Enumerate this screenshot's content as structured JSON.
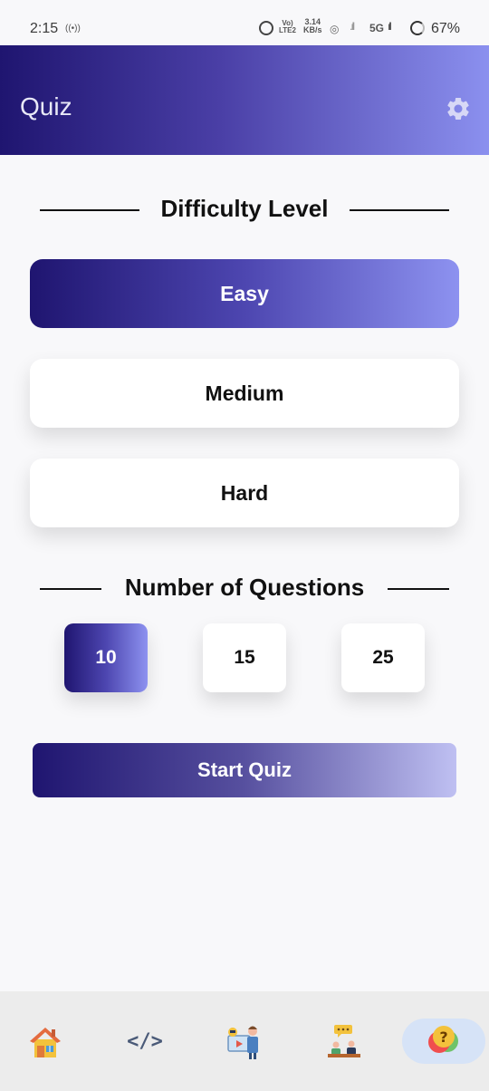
{
  "status_bar": {
    "time": "2:15",
    "radio": "((•))",
    "volte_top": "Vo)",
    "volte_bottom": "LTE2",
    "speed_value": "3.14",
    "speed_unit": "KB/s",
    "network": "5G",
    "battery": "67%"
  },
  "app_bar": {
    "title": "Quiz",
    "settings_icon": "gear-icon"
  },
  "difficulty": {
    "heading": "Difficulty Level",
    "options": [
      {
        "label": "Easy",
        "selected": true
      },
      {
        "label": "Medium",
        "selected": false
      },
      {
        "label": "Hard",
        "selected": false
      }
    ]
  },
  "questions": {
    "heading": "Number of Questions",
    "options": [
      {
        "label": "10",
        "selected": true
      },
      {
        "label": "15",
        "selected": false
      },
      {
        "label": "25",
        "selected": false
      }
    ]
  },
  "start_button": "Start Quiz",
  "bottom_nav": {
    "items": [
      {
        "icon": "home-icon",
        "active": false
      },
      {
        "icon": "code-icon",
        "glyph": "</>",
        "active": false
      },
      {
        "icon": "teacher-icon",
        "active": false
      },
      {
        "icon": "discussion-icon",
        "active": false
      },
      {
        "icon": "quiz-icon",
        "active": true
      }
    ]
  },
  "colors": {
    "gradient_start": "#1f1570",
    "gradient_end": "#8d92f0",
    "background": "#f8f8fa"
  }
}
